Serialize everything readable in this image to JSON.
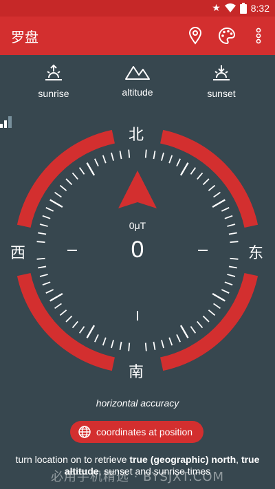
{
  "status_bar": {
    "time": "8:32",
    "icons": [
      "star-icon",
      "wifi-icon",
      "battery-icon"
    ]
  },
  "app_bar": {
    "title": "罗盘",
    "actions": [
      "location-pin-icon",
      "palette-icon",
      "more-vert-icon"
    ]
  },
  "info": {
    "sunrise": "sunrise",
    "altitude": "altitude",
    "sunset": "sunset"
  },
  "compass": {
    "north": "北",
    "east": "东",
    "south": "南",
    "west": "西",
    "magnetic_field": "0μT",
    "heading": "0",
    "signal_strength": 0.5
  },
  "accuracy_label": "horizontal accuracy",
  "coordinates_button": "coordinates at position",
  "hint": {
    "part1": "turn location on to retrieve ",
    "bold1": "true (geographic) north",
    "part2": ", ",
    "bold2": "true altitude",
    "part3": ", sunset and sunrise times"
  },
  "watermark": "必用手机精选 · BYSJXT.COM",
  "colors": {
    "primary": "#d32f2f",
    "primary_dark": "#c62828",
    "background": "#37474f",
    "text": "#ffffff"
  }
}
